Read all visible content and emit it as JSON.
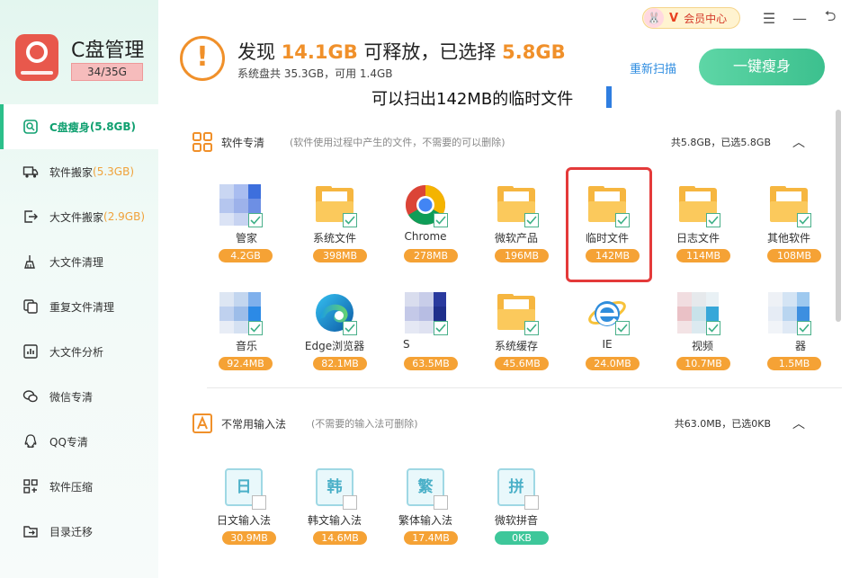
{
  "app": {
    "title": "C盘管理",
    "usage": "34/35G"
  },
  "sidebar": {
    "items": [
      {
        "label": "C盘瘦身",
        "count": "(5.8GB)",
        "icon": "slim-icon"
      },
      {
        "label": "软件搬家",
        "count": "(5.3GB)",
        "icon": "truck-icon"
      },
      {
        "label": "大文件搬家",
        "count": "(2.9GB)",
        "icon": "export-icon"
      },
      {
        "label": "大文件清理",
        "count": "",
        "icon": "broom-icon"
      },
      {
        "label": "重复文件清理",
        "count": "",
        "icon": "duplicate-icon"
      },
      {
        "label": "大文件分析",
        "count": "",
        "icon": "chart-icon"
      },
      {
        "label": "微信专清",
        "count": "",
        "icon": "wechat-icon"
      },
      {
        "label": "QQ专清",
        "count": "",
        "icon": "qq-icon"
      },
      {
        "label": "软件压缩",
        "count": "",
        "icon": "compress-icon"
      },
      {
        "label": "目录迁移",
        "count": "",
        "icon": "folder-move-icon"
      }
    ]
  },
  "topbar": {
    "vip_label": "会员中心",
    "vip_badge": "V",
    "menu": "☰",
    "minimize": "—",
    "back": "⮌"
  },
  "header": {
    "prefix": "发现",
    "found": "14.1GB",
    "mid": "可释放，已选择",
    "selected": "5.8GB",
    "sub": "系统盘共 35.3GB，可用 1.4GB",
    "rescan": "重新扫描",
    "slim_button": "一键瘦身",
    "warn_symbol": "!"
  },
  "annotation": "可以扫出142MB的临时文件",
  "sections": [
    {
      "title": "软件专清",
      "desc": "(软件使用过程中产生的文件，不需要的可以删除)",
      "summary": "共5.8GB，已选5.8GB",
      "toggle": "︿",
      "items": [
        {
          "name": "管家",
          "size": "4.2GB",
          "icon": "blurred-app-icon",
          "checked": true
        },
        {
          "name": "系统文件",
          "size": "398MB",
          "icon": "folder-icon",
          "checked": true
        },
        {
          "name": "Chrome",
          "size": "278MB",
          "icon": "chrome-icon",
          "checked": true
        },
        {
          "name": "微软产品",
          "size": "196MB",
          "icon": "folder-icon",
          "checked": true
        },
        {
          "name": "临时文件",
          "size": "142MB",
          "icon": "folder-icon",
          "checked": true
        },
        {
          "name": "日志文件",
          "size": "114MB",
          "icon": "folder-icon",
          "checked": true
        },
        {
          "name": "其他软件",
          "size": "108MB",
          "icon": "folder-icon",
          "checked": true
        },
        {
          "name": "音乐",
          "size": "92.4MB",
          "icon": "blurred-app-icon",
          "checked": true
        },
        {
          "name": "Edge浏览器",
          "size": "82.1MB",
          "icon": "edge-icon",
          "checked": true
        },
        {
          "name": "S",
          "size": "63.5MB",
          "icon": "blurred-app-icon",
          "checked": true
        },
        {
          "name": "系统缓存",
          "size": "45.6MB",
          "icon": "folder-icon",
          "checked": true
        },
        {
          "name": "IE",
          "size": "24.0MB",
          "icon": "ie-icon",
          "checked": true
        },
        {
          "name": "视频",
          "size": "10.7MB",
          "icon": "blurred-app-icon",
          "checked": true
        },
        {
          "name": "器",
          "size": "1.5MB",
          "icon": "blurred-app-icon",
          "checked": true
        }
      ]
    },
    {
      "title": "不常用输入法",
      "desc": "(不需要的输入法可删除)",
      "summary": "共63.0MB，已选0KB",
      "toggle": "︿",
      "items": [
        {
          "name": "日文输入法",
          "size": "30.9MB",
          "glyph": "日",
          "checked": false
        },
        {
          "name": "韩文输入法",
          "size": "14.6MB",
          "glyph": "韩",
          "checked": false
        },
        {
          "name": "繁体输入法",
          "size": "17.4MB",
          "glyph": "繁",
          "checked": false
        },
        {
          "name": "微软拼音",
          "size": "0KB",
          "glyph": "拼",
          "checked": false
        }
      ]
    }
  ],
  "colors": {
    "accent": "#3cc08e",
    "warning": "#f0902a",
    "size_badge": "#f5a235",
    "highlight": "#e43a3a",
    "link": "#2f8de0"
  }
}
